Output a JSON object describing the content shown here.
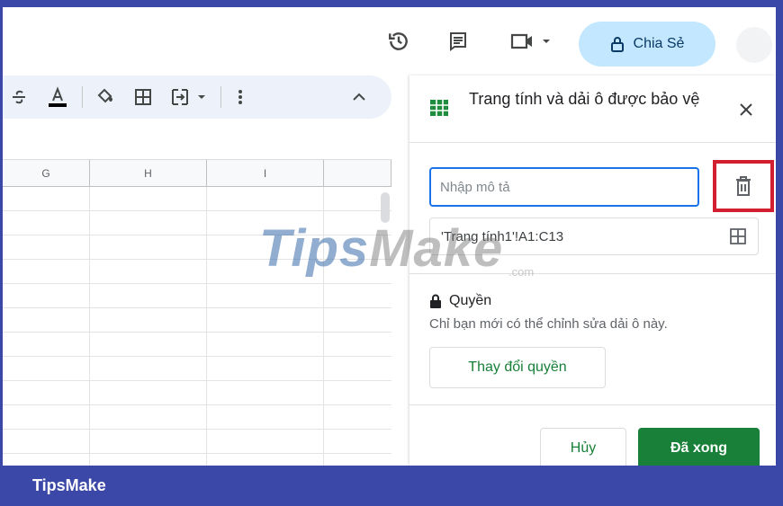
{
  "toolbar": {
    "share_label": "Chia Sẻ",
    "merge_label": "⊟"
  },
  "panel": {
    "title": "Trang tính và dải ô được bảo vệ",
    "description_placeholder": "Nhập mô tả",
    "range_value": "'Trang tính1'!A1:C13",
    "permission_heading": "Quyền",
    "permission_desc": "Chỉ bạn mới có thể chỉnh sửa dải ô này.",
    "change_permission_label": "Thay đổi quyền",
    "cancel_label": "Hủy",
    "done_label": "Đã xong"
  },
  "sheet": {
    "columns": [
      "G",
      "H",
      "I"
    ]
  },
  "watermark": {
    "logo_first": "Tips",
    "logo_rest": "Make",
    "suffix": ".com"
  },
  "footer": {
    "brand": "TipsMake"
  },
  "colors": {
    "frame": "#3c48a8",
    "share_bg": "#c2e7ff",
    "accent_green": "#188038",
    "highlight_red": "#d32030",
    "focus_blue": "#1a73e8"
  },
  "icons": [
    "history-icon",
    "comment-icon",
    "meet-icon",
    "lock-icon",
    "strikethrough-icon",
    "text-color-icon",
    "fill-color-icon",
    "borders-icon",
    "merge-cells-icon",
    "more-vert-icon",
    "collapse-icon",
    "sheets-table-icon",
    "close-icon",
    "trash-icon",
    "grid-range-icon"
  ]
}
